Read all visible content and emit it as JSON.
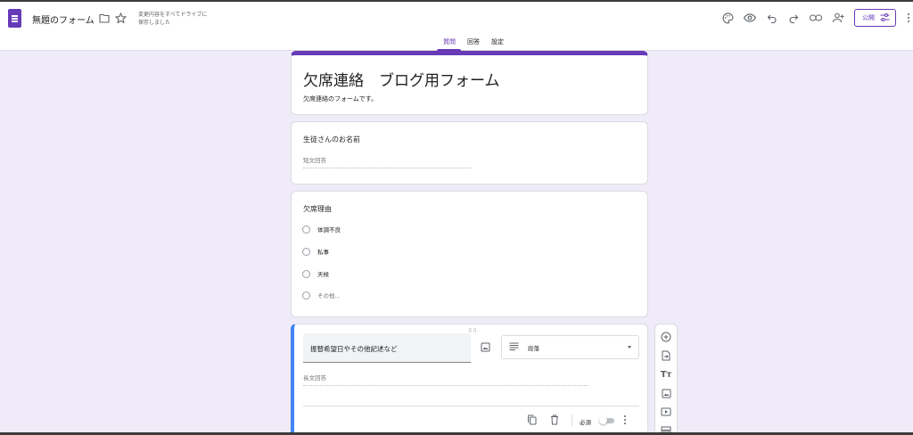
{
  "header": {
    "doc_title": "無題のフォーム",
    "save_status_line1": "変更内容をすべてドライブに",
    "save_status_line2": "保存しました",
    "publish_label": "公開",
    "icons": [
      "forms-app-icon",
      "folder-icon",
      "star-icon",
      "palette-icon",
      "preview-icon",
      "undo-icon",
      "redo-icon",
      "link-icon",
      "add-collaborator-icon",
      "publish-settings-icon",
      "more-vert-icon"
    ]
  },
  "tabs": [
    {
      "label": "質問",
      "active": true
    },
    {
      "label": "回答",
      "active": false
    },
    {
      "label": "設定",
      "active": false
    }
  ],
  "form": {
    "title": "欠席連絡　ブログ用フォーム",
    "description": "欠席連絡のフォームです。"
  },
  "questions": [
    {
      "title": "生徒さんのお名前",
      "placeholder": "短文回答"
    },
    {
      "title": "欠席理由",
      "options": [
        "体調不良",
        "私事",
        "天候"
      ],
      "other_option": "その他..."
    },
    {
      "title": "振替希望日やその他記述など",
      "type_label": "段落",
      "placeholder": "長文回答",
      "required_label": "必須",
      "required": false
    }
  ],
  "side_toolbar": [
    "add-question-icon",
    "import-questions-icon",
    "add-title-icon",
    "add-image-icon",
    "add-video-icon",
    "add-section-icon"
  ],
  "colors": {
    "accent": "#673ab7",
    "page_background": "#f0ebf8",
    "active_question_border": "#4285f4"
  }
}
